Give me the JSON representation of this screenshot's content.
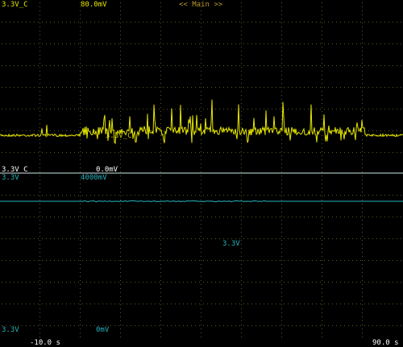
{
  "top": {
    "channel_c_name": "3.3V_C",
    "channel_c_scale": "80.0mV",
    "mode_label": "<< Main >>"
  },
  "divider": {
    "channel_c_name": "3.3V_C",
    "channel_c_offset": "0.0mV",
    "channel_v_name": "3.3V",
    "channel_v_scale": "4000mV"
  },
  "trace_labels": {
    "channel_c_marker": "3.3V_C",
    "channel_v_marker": "3.3V"
  },
  "bottom": {
    "channel_v_name": "3.3V",
    "channel_v_offset": "0mV",
    "time_start": "-10.0 s",
    "time_end": "90.0 s"
  },
  "colors": {
    "yellow_trace": "#e6e600",
    "cyan_trace": "#27b3bd",
    "grid": "#5a5a1e",
    "divider": "#cfe8ea"
  }
}
